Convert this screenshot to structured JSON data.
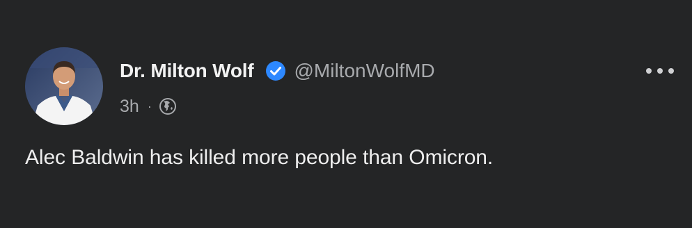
{
  "post": {
    "author_name": "Dr. Milton Wolf",
    "handle": "@MiltonWolfMD",
    "timestamp": "3h",
    "separator": "·",
    "visibility_icon": "globe-icon",
    "verified_icon": "verified-badge-icon",
    "more_icon": "more-options-icon",
    "text": "Alec Baldwin has killed more people than Omicron."
  },
  "colors": {
    "background": "#242526",
    "verified_badge": "#2d88ff",
    "primary_text": "#f2f2f2",
    "secondary_text": "#a8aaad"
  }
}
